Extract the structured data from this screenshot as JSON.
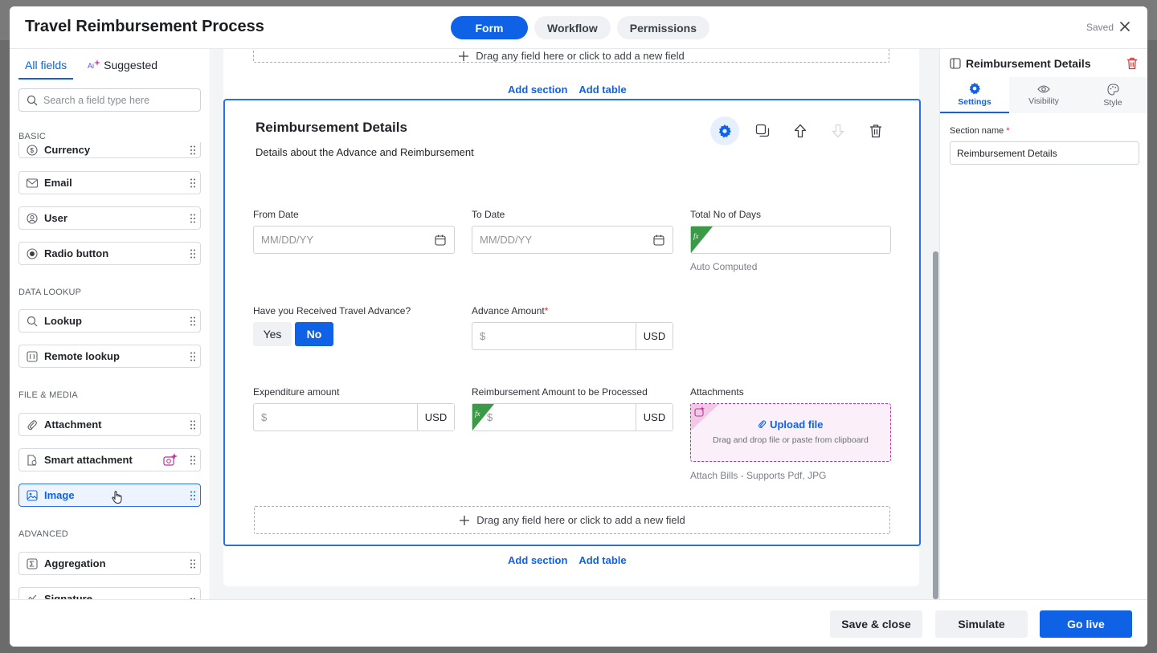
{
  "header": {
    "title": "Travel Reimbursement Process",
    "tabs": [
      {
        "label": "Form",
        "active": true
      },
      {
        "label": "Workflow",
        "active": false
      },
      {
        "label": "Permissions",
        "active": false
      }
    ],
    "saved_status": "Saved"
  },
  "left_panel": {
    "tabs": {
      "all_fields": "All fields",
      "suggested": "Suggested"
    },
    "search_placeholder": "Search a field type here",
    "groups": {
      "basic": "BASIC",
      "data_lookup": "DATA LOOKUP",
      "file_media": "FILE & MEDIA",
      "advanced": "ADVANCED"
    },
    "fields": {
      "currency": "Currency",
      "email": "Email",
      "user": "User",
      "radio": "Radio button",
      "lookup": "Lookup",
      "remote_lookup": "Remote lookup",
      "attachment": "Attachment",
      "smart_attachment": "Smart attachment",
      "image": "Image",
      "aggregation": "Aggregation",
      "signature": "Signature"
    }
  },
  "canvas": {
    "drop_hint": "Drag any field here or click to add a new field",
    "add_section": "Add section",
    "add_table": "Add table",
    "section": {
      "title": "Reimbursement Details",
      "description": "Details about the Advance and Reimbursement",
      "from_date": {
        "label": "From Date",
        "placeholder": "MM/DD/YY"
      },
      "to_date": {
        "label": "To Date",
        "placeholder": "MM/DD/YY"
      },
      "total_days": {
        "label": "Total No of Days",
        "helper": "Auto Computed"
      },
      "travel_advance": {
        "label": "Have you Received Travel Advance?",
        "yes": "Yes",
        "no": "No",
        "selected": "No"
      },
      "advance_amount": {
        "label": "Advance Amount",
        "required_mark": "*",
        "prefix": "$",
        "currency": "USD"
      },
      "expenditure": {
        "label": "Expenditure amount",
        "prefix": "$",
        "currency": "USD"
      },
      "reimbursement": {
        "label": "Reimbursement Amount to be Processed",
        "prefix": "$",
        "currency": "USD"
      },
      "attachments": {
        "label": "Attachments",
        "upload": "Upload file",
        "upload_hint": "Drag and drop file or paste from clipboard",
        "helper": "Attach Bills - Supports Pdf, JPG"
      }
    }
  },
  "right_panel": {
    "title": "Reimbursement Details",
    "tabs": [
      {
        "label": "Settings",
        "active": true
      },
      {
        "label": "Visibility",
        "active": false
      },
      {
        "label": "Style",
        "active": false
      }
    ],
    "section_name_label": "Section name",
    "required_mark": "*",
    "section_name_value": "Reimbursement Details"
  },
  "footer": {
    "save_close": "Save & close",
    "simulate": "Simulate",
    "go_live": "Go live"
  },
  "colors": {
    "accent": "#0f62e6",
    "formula_badge": "#3a9a46",
    "smart_badge": "#b9379c",
    "danger": "#d92c2c"
  }
}
